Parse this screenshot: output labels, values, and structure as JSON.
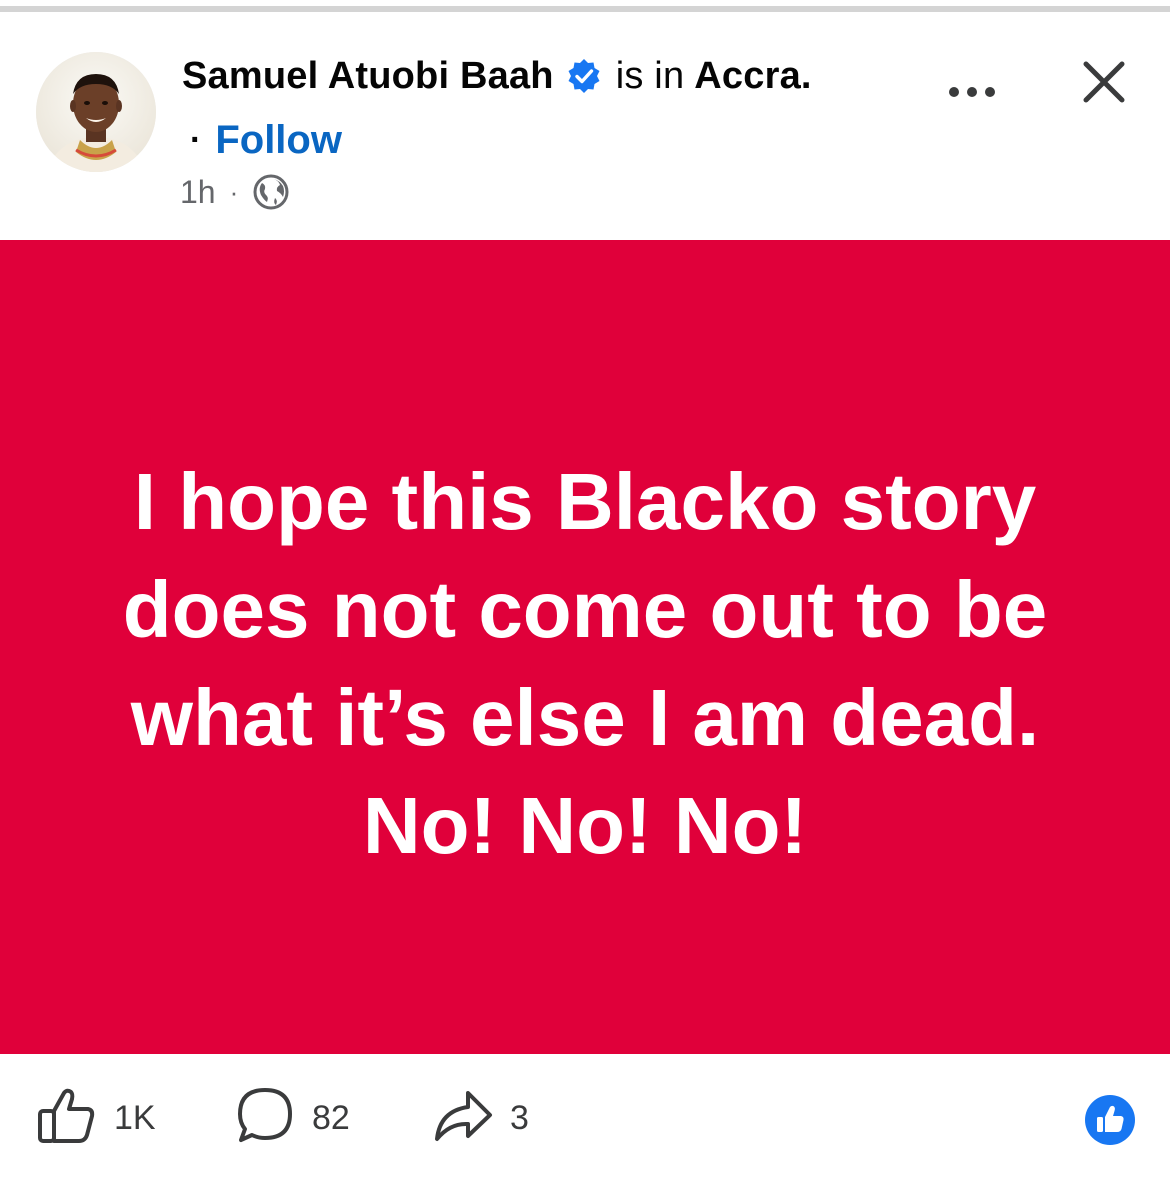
{
  "colors": {
    "post_background": "#e0003a",
    "link": "#0a66c2",
    "verified_badge": "#1877f2",
    "muted_text": "#65676b"
  },
  "post": {
    "author": {
      "name": "Samuel Atuobi Baah",
      "verified": true,
      "verified_icon": "verified-badge-icon"
    },
    "location": {
      "prefix": "is in",
      "name": "Accra."
    },
    "follow_label": "Follow",
    "follow_separator": "·",
    "timestamp": "1h",
    "meta_separator": "·",
    "audience_icon": "globe-icon",
    "more_icon": "more-options-icon",
    "close_icon": "close-icon",
    "text": "I hope this Blacko story does not come out to be what it’s else I am dead. No! No! No!"
  },
  "actions": {
    "like": {
      "icon": "like-icon",
      "count": "1K"
    },
    "comment": {
      "icon": "comment-icon",
      "count": "82"
    },
    "share": {
      "icon": "share-icon",
      "count": "3"
    },
    "reaction_badge_icon": "like-reaction-icon"
  }
}
